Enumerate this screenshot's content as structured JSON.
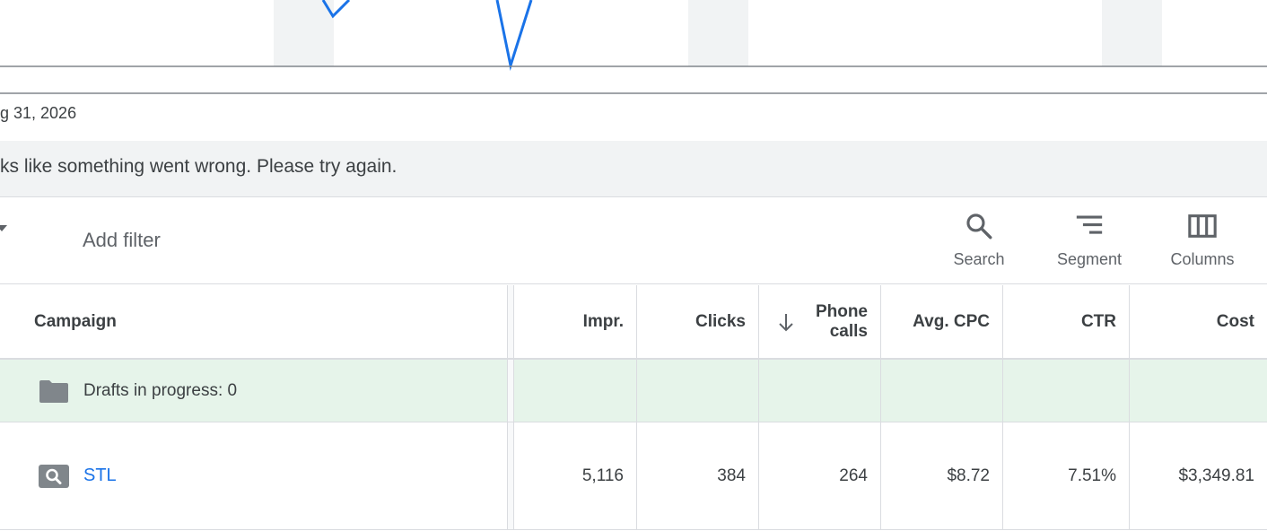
{
  "date_label": "g 31, 2026",
  "error_message": "ks like something went wrong. Please try again.",
  "toolbar": {
    "add_filter": "Add filter",
    "search_label": "Search",
    "segment_label": "Segment",
    "columns_label": "Columns"
  },
  "table": {
    "headers": {
      "campaign": "Campaign",
      "impr": "Impr.",
      "clicks": "Clicks",
      "phone_calls": "Phone calls",
      "avg_cpc": "Avg. CPC",
      "ctr": "CTR",
      "cost": "Cost"
    },
    "drafts_row": {
      "label": "Drafts in progress: 0"
    },
    "rows": [
      {
        "campaign": "STL",
        "impr": "5,116",
        "clicks": "384",
        "phone_calls": "264",
        "avg_cpc": "$8.72",
        "ctr": "7.51%",
        "cost": "$3,349.81"
      }
    ]
  },
  "icons": {
    "search_tool": "search-icon",
    "segment_tool": "segment-icon",
    "columns_tool": "columns-icon",
    "drafts": "folder-icon",
    "campaign_type": "search-campaign-icon",
    "sort": "arrow-down-icon"
  },
  "colors": {
    "accent": "#1a73e8",
    "chart_line": "#1a73e8",
    "drafts_row_bg": "#e6f4ea",
    "banner_bg": "#f1f3f4"
  }
}
